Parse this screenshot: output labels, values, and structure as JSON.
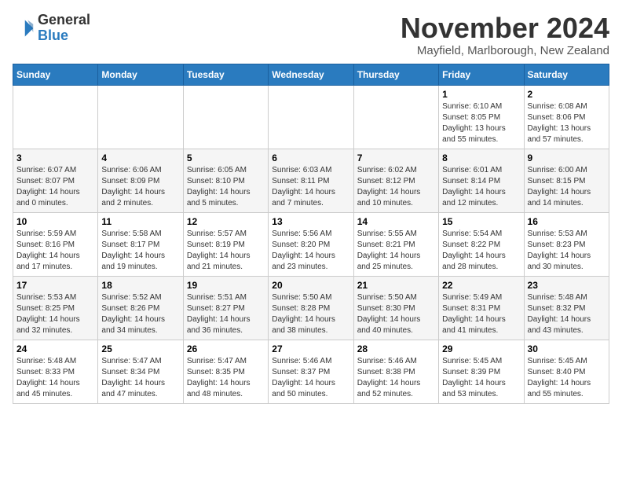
{
  "logo": {
    "general": "General",
    "blue": "Blue"
  },
  "title": "November 2024",
  "location": "Mayfield, Marlborough, New Zealand",
  "headers": [
    "Sunday",
    "Monday",
    "Tuesday",
    "Wednesday",
    "Thursday",
    "Friday",
    "Saturday"
  ],
  "weeks": [
    [
      {
        "day": "",
        "info": ""
      },
      {
        "day": "",
        "info": ""
      },
      {
        "day": "",
        "info": ""
      },
      {
        "day": "",
        "info": ""
      },
      {
        "day": "",
        "info": ""
      },
      {
        "day": "1",
        "info": "Sunrise: 6:10 AM\nSunset: 8:05 PM\nDaylight: 13 hours\nand 55 minutes."
      },
      {
        "day": "2",
        "info": "Sunrise: 6:08 AM\nSunset: 8:06 PM\nDaylight: 13 hours\nand 57 minutes."
      }
    ],
    [
      {
        "day": "3",
        "info": "Sunrise: 6:07 AM\nSunset: 8:07 PM\nDaylight: 14 hours\nand 0 minutes."
      },
      {
        "day": "4",
        "info": "Sunrise: 6:06 AM\nSunset: 8:09 PM\nDaylight: 14 hours\nand 2 minutes."
      },
      {
        "day": "5",
        "info": "Sunrise: 6:05 AM\nSunset: 8:10 PM\nDaylight: 14 hours\nand 5 minutes."
      },
      {
        "day": "6",
        "info": "Sunrise: 6:03 AM\nSunset: 8:11 PM\nDaylight: 14 hours\nand 7 minutes."
      },
      {
        "day": "7",
        "info": "Sunrise: 6:02 AM\nSunset: 8:12 PM\nDaylight: 14 hours\nand 10 minutes."
      },
      {
        "day": "8",
        "info": "Sunrise: 6:01 AM\nSunset: 8:14 PM\nDaylight: 14 hours\nand 12 minutes."
      },
      {
        "day": "9",
        "info": "Sunrise: 6:00 AM\nSunset: 8:15 PM\nDaylight: 14 hours\nand 14 minutes."
      }
    ],
    [
      {
        "day": "10",
        "info": "Sunrise: 5:59 AM\nSunset: 8:16 PM\nDaylight: 14 hours\nand 17 minutes."
      },
      {
        "day": "11",
        "info": "Sunrise: 5:58 AM\nSunset: 8:17 PM\nDaylight: 14 hours\nand 19 minutes."
      },
      {
        "day": "12",
        "info": "Sunrise: 5:57 AM\nSunset: 8:19 PM\nDaylight: 14 hours\nand 21 minutes."
      },
      {
        "day": "13",
        "info": "Sunrise: 5:56 AM\nSunset: 8:20 PM\nDaylight: 14 hours\nand 23 minutes."
      },
      {
        "day": "14",
        "info": "Sunrise: 5:55 AM\nSunset: 8:21 PM\nDaylight: 14 hours\nand 25 minutes."
      },
      {
        "day": "15",
        "info": "Sunrise: 5:54 AM\nSunset: 8:22 PM\nDaylight: 14 hours\nand 28 minutes."
      },
      {
        "day": "16",
        "info": "Sunrise: 5:53 AM\nSunset: 8:23 PM\nDaylight: 14 hours\nand 30 minutes."
      }
    ],
    [
      {
        "day": "17",
        "info": "Sunrise: 5:53 AM\nSunset: 8:25 PM\nDaylight: 14 hours\nand 32 minutes."
      },
      {
        "day": "18",
        "info": "Sunrise: 5:52 AM\nSunset: 8:26 PM\nDaylight: 14 hours\nand 34 minutes."
      },
      {
        "day": "19",
        "info": "Sunrise: 5:51 AM\nSunset: 8:27 PM\nDaylight: 14 hours\nand 36 minutes."
      },
      {
        "day": "20",
        "info": "Sunrise: 5:50 AM\nSunset: 8:28 PM\nDaylight: 14 hours\nand 38 minutes."
      },
      {
        "day": "21",
        "info": "Sunrise: 5:50 AM\nSunset: 8:30 PM\nDaylight: 14 hours\nand 40 minutes."
      },
      {
        "day": "22",
        "info": "Sunrise: 5:49 AM\nSunset: 8:31 PM\nDaylight: 14 hours\nand 41 minutes."
      },
      {
        "day": "23",
        "info": "Sunrise: 5:48 AM\nSunset: 8:32 PM\nDaylight: 14 hours\nand 43 minutes."
      }
    ],
    [
      {
        "day": "24",
        "info": "Sunrise: 5:48 AM\nSunset: 8:33 PM\nDaylight: 14 hours\nand 45 minutes."
      },
      {
        "day": "25",
        "info": "Sunrise: 5:47 AM\nSunset: 8:34 PM\nDaylight: 14 hours\nand 47 minutes."
      },
      {
        "day": "26",
        "info": "Sunrise: 5:47 AM\nSunset: 8:35 PM\nDaylight: 14 hours\nand 48 minutes."
      },
      {
        "day": "27",
        "info": "Sunrise: 5:46 AM\nSunset: 8:37 PM\nDaylight: 14 hours\nand 50 minutes."
      },
      {
        "day": "28",
        "info": "Sunrise: 5:46 AM\nSunset: 8:38 PM\nDaylight: 14 hours\nand 52 minutes."
      },
      {
        "day": "29",
        "info": "Sunrise: 5:45 AM\nSunset: 8:39 PM\nDaylight: 14 hours\nand 53 minutes."
      },
      {
        "day": "30",
        "info": "Sunrise: 5:45 AM\nSunset: 8:40 PM\nDaylight: 14 hours\nand 55 minutes."
      }
    ]
  ]
}
